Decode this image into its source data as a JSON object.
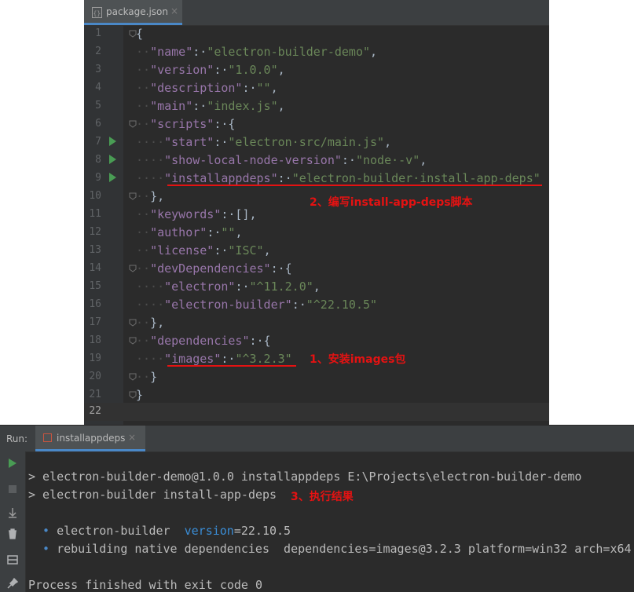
{
  "editor": {
    "tab": {
      "file_name": "package.json",
      "close": "×"
    },
    "line_numbers": [
      "1",
      "2",
      "3",
      "4",
      "5",
      "6",
      "7",
      "8",
      "9",
      "10",
      "11",
      "12",
      "13",
      "14",
      "15",
      "16",
      "17",
      "18",
      "19",
      "20",
      "21",
      "22"
    ],
    "lines": [
      {
        "ws": "",
        "tokens": [
          {
            "t": "p",
            "v": "{"
          }
        ]
      },
      {
        "ws": "··",
        "tokens": [
          {
            "t": "k",
            "v": "\"name\""
          },
          {
            "t": "p",
            "v": ":·"
          },
          {
            "t": "s",
            "v": "\"electron-builder-demo\""
          },
          {
            "t": "p",
            "v": ","
          }
        ]
      },
      {
        "ws": "··",
        "tokens": [
          {
            "t": "k",
            "v": "\"version\""
          },
          {
            "t": "p",
            "v": ":·"
          },
          {
            "t": "s",
            "v": "\"1.0.0\""
          },
          {
            "t": "p",
            "v": ","
          }
        ]
      },
      {
        "ws": "··",
        "tokens": [
          {
            "t": "k",
            "v": "\"description\""
          },
          {
            "t": "p",
            "v": ":·"
          },
          {
            "t": "s",
            "v": "\"\""
          },
          {
            "t": "p",
            "v": ","
          }
        ]
      },
      {
        "ws": "··",
        "tokens": [
          {
            "t": "k",
            "v": "\"main\""
          },
          {
            "t": "p",
            "v": ":·"
          },
          {
            "t": "s",
            "v": "\"index.js\""
          },
          {
            "t": "p",
            "v": ","
          }
        ]
      },
      {
        "ws": "··",
        "tokens": [
          {
            "t": "k",
            "v": "\"scripts\""
          },
          {
            "t": "p",
            "v": ":·{"
          }
        ]
      },
      {
        "ws": "····",
        "tokens": [
          {
            "t": "k",
            "v": "\"start\""
          },
          {
            "t": "p",
            "v": ":·"
          },
          {
            "t": "s",
            "v": "\"electron·src/main.js\""
          },
          {
            "t": "p",
            "v": ","
          }
        ]
      },
      {
        "ws": "····",
        "tokens": [
          {
            "t": "k",
            "v": "\"show-local-node-version\""
          },
          {
            "t": "p",
            "v": ":·"
          },
          {
            "t": "s",
            "v": "\"node·-v\""
          },
          {
            "t": "p",
            "v": ","
          }
        ]
      },
      {
        "ws": "····",
        "tokens": [
          {
            "t": "k",
            "v": "\"installappdeps\""
          },
          {
            "t": "p",
            "v": ":·"
          },
          {
            "t": "s",
            "v": "\"electron-builder·install-app-deps\""
          }
        ]
      },
      {
        "ws": "··",
        "tokens": [
          {
            "t": "p",
            "v": "},"
          }
        ]
      },
      {
        "ws": "··",
        "tokens": [
          {
            "t": "k",
            "v": "\"keywords\""
          },
          {
            "t": "p",
            "v": ":·[],"
          }
        ]
      },
      {
        "ws": "··",
        "tokens": [
          {
            "t": "k",
            "v": "\"author\""
          },
          {
            "t": "p",
            "v": ":·"
          },
          {
            "t": "s",
            "v": "\"\""
          },
          {
            "t": "p",
            "v": ","
          }
        ]
      },
      {
        "ws": "··",
        "tokens": [
          {
            "t": "k",
            "v": "\"license\""
          },
          {
            "t": "p",
            "v": ":·"
          },
          {
            "t": "s",
            "v": "\"ISC\""
          },
          {
            "t": "p",
            "v": ","
          }
        ]
      },
      {
        "ws": "··",
        "tokens": [
          {
            "t": "k",
            "v": "\"devDependencies\""
          },
          {
            "t": "p",
            "v": ":·{"
          }
        ]
      },
      {
        "ws": "····",
        "tokens": [
          {
            "t": "k",
            "v": "\"electron\""
          },
          {
            "t": "p",
            "v": ":·"
          },
          {
            "t": "s",
            "v": "\"^11.2.0\""
          },
          {
            "t": "p",
            "v": ","
          }
        ]
      },
      {
        "ws": "····",
        "tokens": [
          {
            "t": "k",
            "v": "\"electron-builder\""
          },
          {
            "t": "p",
            "v": ":·"
          },
          {
            "t": "s",
            "v": "\"^22.10.5\""
          }
        ]
      },
      {
        "ws": "··",
        "tokens": [
          {
            "t": "p",
            "v": "},"
          }
        ]
      },
      {
        "ws": "··",
        "tokens": [
          {
            "t": "k",
            "v": "\"dependencies\""
          },
          {
            "t": "p",
            "v": ":·{"
          }
        ]
      },
      {
        "ws": "····",
        "tokens": [
          {
            "t": "k",
            "v": "\"images\""
          },
          {
            "t": "p",
            "v": ":·"
          },
          {
            "t": "s",
            "v": "\"^3.2.3\""
          }
        ]
      },
      {
        "ws": "··",
        "tokens": [
          {
            "t": "p",
            "v": "}"
          }
        ]
      },
      {
        "ws": "",
        "tokens": [
          {
            "t": "p",
            "v": "}"
          }
        ]
      },
      {
        "ws": "",
        "tokens": []
      }
    ],
    "annotations": {
      "step2": "2、编写install-app-deps脚本",
      "step1": "1、安装images包",
      "step3": "3、执行结果"
    }
  },
  "run": {
    "label": "Run:",
    "tab_label": "installappdeps",
    "tab_close": "×",
    "output": {
      "line1": "> electron-builder-demo@1.0.0 installappdeps E:\\Projects\\electron-builder-demo",
      "line2": "> electron-builder install-app-deps",
      "bullet": "•",
      "line3_name": "electron-builder",
      "line3_key": "version",
      "line3_val": "=22.10.5",
      "line4": "rebuilding native dependencies  dependencies=images@3.2.3 platform=win32 arch=x64",
      "line5": "Process finished with exit code 0"
    }
  },
  "colors": {
    "editor_bg": "#2b2b2b",
    "gutter_bg": "#313335",
    "key": "#9876aa",
    "string": "#6a8759",
    "punct": "#a9b7c6",
    "annotation_red": "#e41212",
    "run_green": "#499c54"
  }
}
